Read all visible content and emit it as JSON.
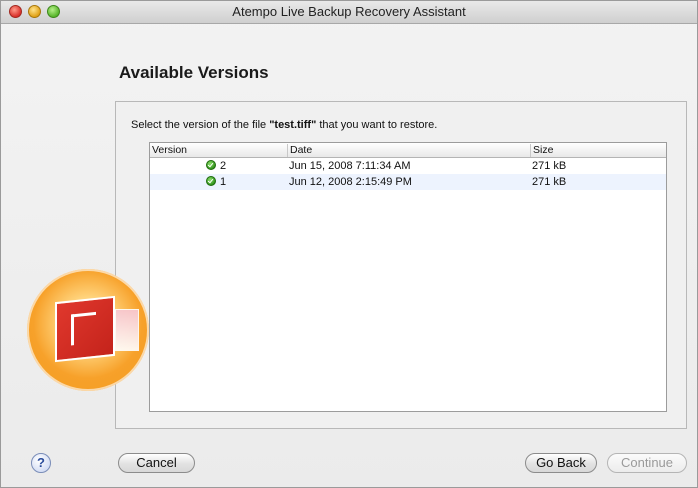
{
  "window": {
    "title": "Atempo Live Backup Recovery Assistant",
    "controls": {
      "close_icon": "close-icon",
      "minimize_icon": "minimize-icon",
      "zoom_icon": "zoom-icon"
    }
  },
  "page": {
    "title": "Available Versions",
    "instruction": {
      "prefix": "Select the version of the file ",
      "filename": "\"test.tiff\"",
      "suffix": " that you want to restore."
    }
  },
  "table": {
    "columns": [
      "Version",
      "Date",
      "Size"
    ],
    "rows": [
      {
        "version": "2",
        "date": "Jun 15, 2008 7:11:34 AM",
        "size": "271 kB",
        "status_icon": "checkmark-icon"
      },
      {
        "version": "1",
        "date": "Jun 12, 2008 2:15:49 PM",
        "size": "271 kB",
        "status_icon": "checkmark-icon"
      }
    ]
  },
  "footer": {
    "help_label": "?",
    "cancel_label": "Cancel",
    "go_back_label": "Go Back",
    "continue_label": "Continue"
  },
  "colors": {
    "status_ok": "#2d8f17",
    "row_alt": "#edf3fe",
    "logo_orange": "#f29b1e",
    "logo_red": "#c4231b"
  }
}
